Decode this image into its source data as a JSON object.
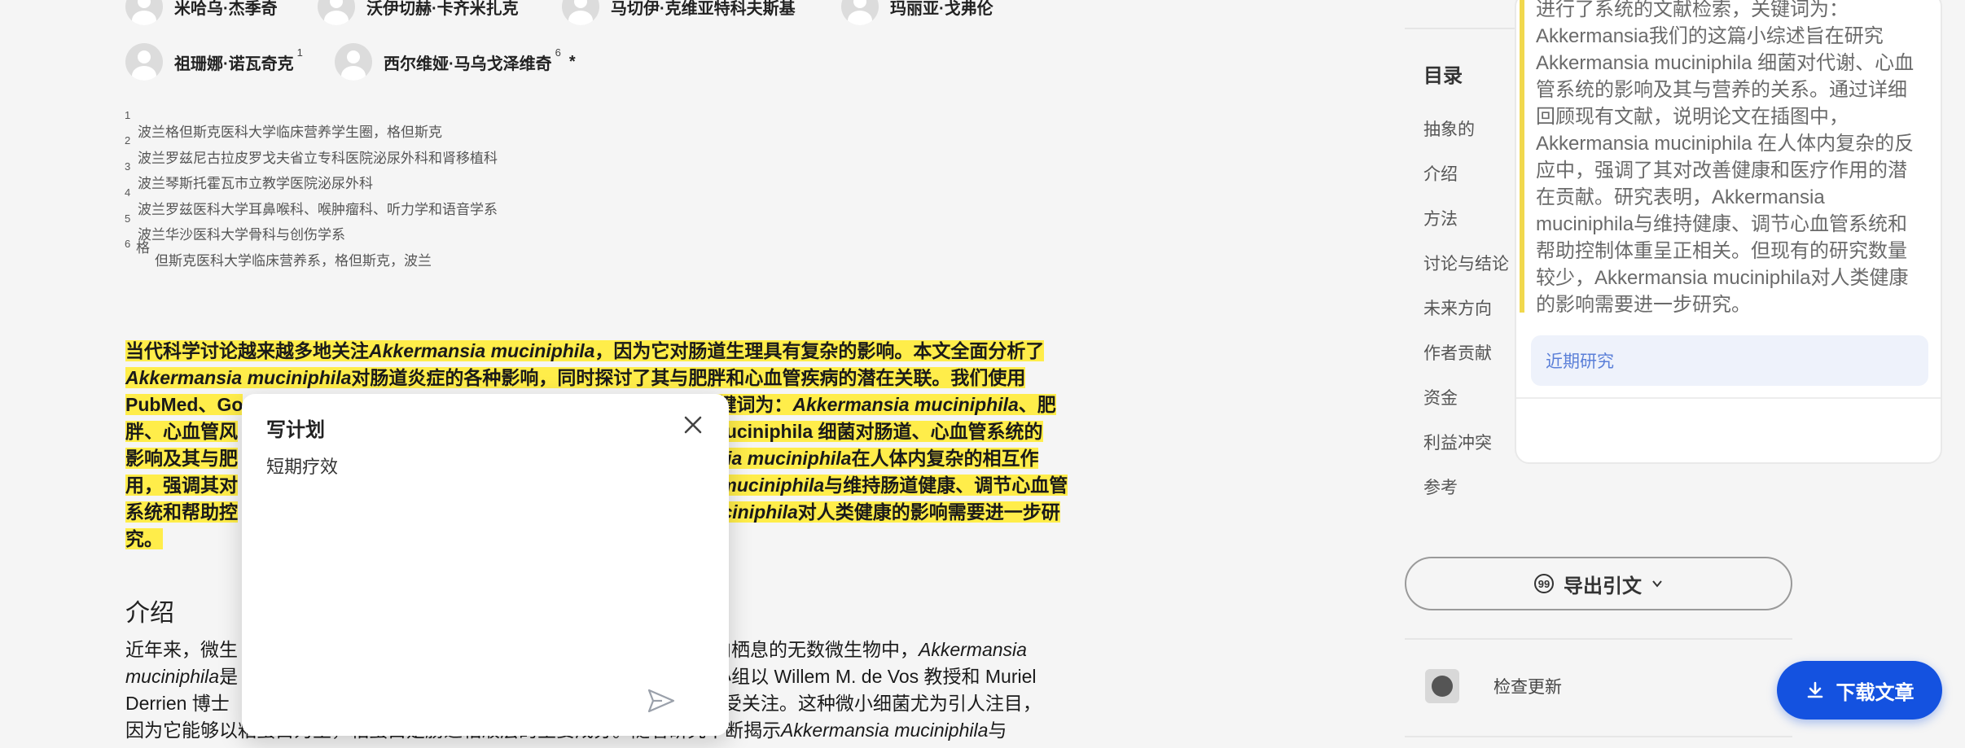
{
  "authors": [
    {
      "name": "米哈乌·杰季奇",
      "sup": ""
    },
    {
      "name": "沃伊切赫·卡齐米扎克",
      "sup": ""
    },
    {
      "name": "马切伊·克维亚特科夫斯基",
      "sup": ""
    },
    {
      "name": "玛丽亚·戈弗伦",
      "sup": ""
    },
    {
      "name": "祖珊娜·诺瓦奇克",
      "sup": "1"
    },
    {
      "name": "西尔维娅·马乌戈泽维奇",
      "sup": "6",
      "star": "*"
    }
  ],
  "affiliations": [
    {
      "num": "1",
      "text": "波兰格但斯克医科大学临床营养学生圈，格但斯克"
    },
    {
      "num": "2",
      "text": "波兰罗兹尼古拉皮罗戈夫省立专科医院泌尿外科和肾移植科"
    },
    {
      "num": "3",
      "text": "波兰琴斯托霍瓦市立教学医院泌尿外科"
    },
    {
      "num": "4",
      "text": "波兰罗兹医科大学耳鼻喉科、喉肿瘤科、听力学和语音学系"
    },
    {
      "num": "5",
      "text": "波兰华沙医科大学骨科与创伤学系"
    },
    {
      "num": "6",
      "text": "格"
    },
    {
      "num": "",
      "text": "但斯克医科大学临床营养系，格但斯克，波兰"
    }
  ],
  "abstract_lines": [
    [
      {
        "t": "当代科学讨论越来越多地关注"
      },
      {
        "t": "Akkermansia muciniphila",
        "i": true
      },
      {
        "t": "，因为它对肠道生理具有复杂的影响。本文全面分析了"
      }
    ],
    [
      {
        "t": "Akkermansia muciniphila",
        "i": true
      },
      {
        "t": "对肠道炎症的各种影响，同时探讨了其与肥胖和心血管疾病的潜在关联。我们使用"
      }
    ],
    [
      {
        "t": "PubMed、Go"
      },
      {
        "gap": 560
      },
      {
        "t": "关键词为："
      },
      {
        "t": "Akkermansia muciniphila",
        "i": true
      },
      {
        "t": "、肥"
      }
    ],
    [
      {
        "t": "胖、心血管风"
      },
      {
        "gap": 540
      },
      {
        "t": "sia",
        "i": true
      },
      {
        "t": " muciniphila 细菌对肠道、心血管系统的"
      }
    ],
    [
      {
        "t": "影响及其与肥"
      },
      {
        "gap": 540
      },
      {
        "t": "mansia muciniphila",
        "i": true
      },
      {
        "t": "在人体内复杂的相互作"
      }
    ],
    [
      {
        "t": "用，强调其对"
      },
      {
        "gap": 540
      },
      {
        "t": "nsia muciniphila",
        "i": true
      },
      {
        "t": "与维持肠道健康、调节心血管"
      }
    ],
    [
      {
        "t": "系统和帮助控"
      },
      {
        "gap": 560
      },
      {
        "t": "muciniphila",
        "i": true
      },
      {
        "t": "对人类健康的影响需要进一步研"
      }
    ],
    [
      {
        "t": "究。"
      }
    ]
  ],
  "intro": {
    "title": "介绍",
    "lines": [
      [
        {
          "t": "近年来，微生"
        },
        {
          "gap": 560
        },
        {
          "t": "道内栖息的无数微生物中，"
        },
        {
          "t": "Akkermansia",
          "i": true
        }
      ],
      [
        {
          "t": "muciniphila",
          "i": true
        },
        {
          "t": "是"
        },
        {
          "gap": 560
        },
        {
          "t": "该小组以 Willem M. de Vos 教授和 Muriel"
        }
      ],
      [
        {
          "t": "Derrien 博士"
        },
        {
          "gap": 560
        },
        {
          "t": "而备受关注。这种微小细菌尤为引人注目，"
        }
      ],
      [
        {
          "t": "因为它能够以粘蛋白为主，粘蛋白是肠道粘液层的主要成分。随着研究不断揭示"
        },
        {
          "t": "Akkermansia muciniphila",
          "i": true
        },
        {
          "t": "与"
        }
      ]
    ]
  },
  "popup": {
    "title": "写计划",
    "text": "短期疗效"
  },
  "sidebar": {
    "summary_lines": [
      "进行了系统的文献检索，关键词为：",
      "Akkermansia我们的这篇小综述旨在研究",
      "Akkermansia muciniphila 细菌对代谢、心血",
      "管系统的影响及其与营养的关系。通过详细",
      "回顾现有文献，说明论文在插图中，",
      "Akkermansia muciniphila 在人体内复杂的反",
      "应中，强调了其对改善健康和医疗作用的潜",
      "在贡献。研究表明，Akkermansia",
      "muciniphila与维持健康、调节心血管系统和",
      "帮助控制体重呈正相关。但现有的研究数量",
      "较少，Akkermansia muciniphila对人类健康",
      "的影响需要进一步研究。"
    ],
    "recent_label": "近期研究",
    "toc_title": "目录",
    "toc_items": [
      "抽象的",
      "介绍",
      "方法",
      "讨论与结论",
      "未来方向",
      "作者贡献",
      "资金",
      "利益冲突",
      "参考"
    ],
    "export_label": "导出引文",
    "export_icon": "99",
    "check_update_label": "检查更新",
    "download_label": "下载文章"
  }
}
